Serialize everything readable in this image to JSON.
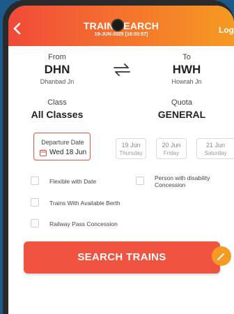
{
  "header": {
    "back_icon": "chevron-left-icon",
    "title": "TRAIN SEARCH",
    "subtitle": "19-JUN-2025 [16:03:57]",
    "login": "Log"
  },
  "journey": {
    "from_label": "From",
    "from_code": "DHN",
    "from_name": "Dhanbad Jn",
    "to_label": "To",
    "to_code": "HWH",
    "to_name": "Howrah Jn",
    "swap_icon": "swap-arrows-icon"
  },
  "class_quota": {
    "class_label": "Class",
    "class_value": "All Classes",
    "quota_label": "Quota",
    "quota_value": "GENERAL"
  },
  "dates": {
    "departure_label": "Departure Date",
    "departure_value": "Wed 18 Jun",
    "calendar_icon": "calendar-icon",
    "options": [
      {
        "date": "19 Jun",
        "day": "Thursday"
      },
      {
        "date": "20 Jun",
        "day": "Friday"
      },
      {
        "date": "21 Jun",
        "day": "Saturday"
      }
    ]
  },
  "filters": [
    {
      "label": "Flexible with Date",
      "checked": false
    },
    {
      "label": "Person with disability Concession",
      "checked": false
    },
    {
      "label": "Trains With Available Berth",
      "checked": false
    },
    {
      "label": "Railway Pass Concession",
      "checked": false
    }
  ],
  "search_button": "SEARCH TRAINS",
  "colors": {
    "accent": "#f0533f",
    "header_start": "#f04a3a",
    "header_end": "#f59a22"
  }
}
